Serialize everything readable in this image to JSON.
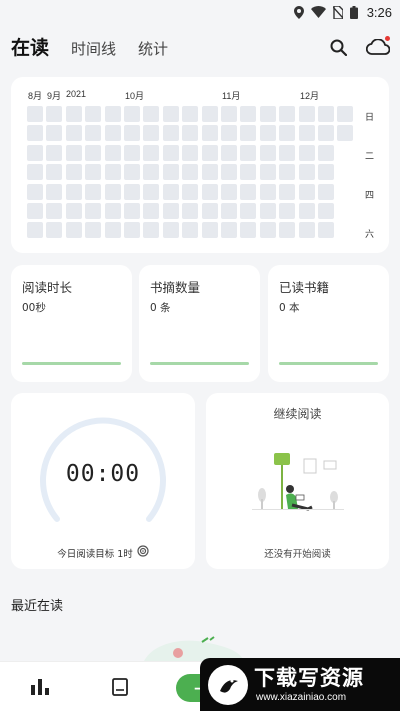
{
  "status_bar": {
    "time": "3:26",
    "icons": [
      "location-icon",
      "wifi-icon",
      "no-sim-icon",
      "battery-icon"
    ]
  },
  "tabs": [
    {
      "label": "在读",
      "active": true
    },
    {
      "label": "时间线",
      "active": false
    },
    {
      "label": "统计",
      "active": false
    }
  ],
  "top_actions": {
    "search_icon": "search-icon",
    "cloud_icon": "cloud-sync-icon",
    "accent": "#e53935"
  },
  "heatmap": {
    "year": "2021",
    "months": [
      "8月",
      "9月",
      "10月",
      "11月",
      "12月"
    ],
    "weekdays": [
      "日",
      "二",
      "四",
      "六"
    ],
    "cell_color": "#e6e9ee"
  },
  "stats": [
    {
      "label": "阅读时长",
      "value": "00秒"
    },
    {
      "label": "书摘数量",
      "value": "0 条"
    },
    {
      "label": "已读书籍",
      "value": "0 本"
    }
  ],
  "timer": {
    "value": "00:00",
    "goal": "今日阅读目标 1时",
    "goal_icon": "target-icon"
  },
  "continue_reading": {
    "title": "继续阅读",
    "empty": "还没有开始阅读"
  },
  "recent": {
    "title": "最近在读"
  },
  "bottom_nav": {
    "items": [
      "stats-bar-chart-icon",
      "book-icon"
    ],
    "fab_label": "+",
    "accent": "#4caf50"
  },
  "watermark": {
    "title": "下载写资源",
    "url": "www.xiazainiao.com"
  }
}
